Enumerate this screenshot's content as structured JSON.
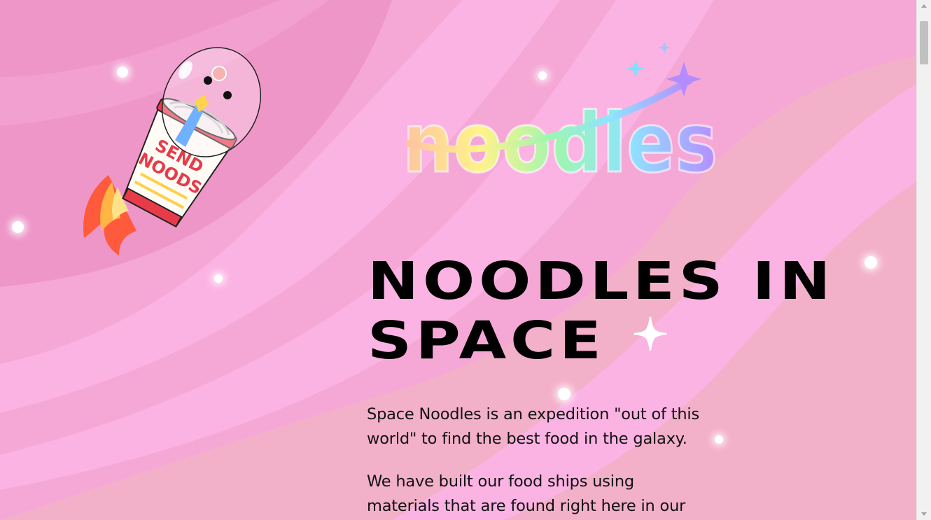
{
  "hero": {
    "title_line1": "NOODLES IN",
    "title_line2": "SPACE"
  },
  "logo": {
    "text": "noodles"
  },
  "rocket": {
    "cup_label_line1": "SEND",
    "cup_label_line2": "NOODS"
  },
  "about": {
    "paragraph_1_line_1": "Space Noodles is an expedition \"out of this",
    "paragraph_1_line_2": "world\" to find the best food in the galaxy.",
    "paragraph_2_line_1": "We have built our food ships using",
    "paragraph_2_line_2": "materials that are found right here in our"
  },
  "colors": {
    "background_pink": "#f3b0c9",
    "stripe_light": "#fbb3e3",
    "stripe_dark": "#ee96c8",
    "title_text": "#000000"
  },
  "icons": {
    "title_sparkle": "sparkle-icon",
    "scroll_up": "arrow-up-icon",
    "scroll_down": "arrow-down-icon"
  }
}
